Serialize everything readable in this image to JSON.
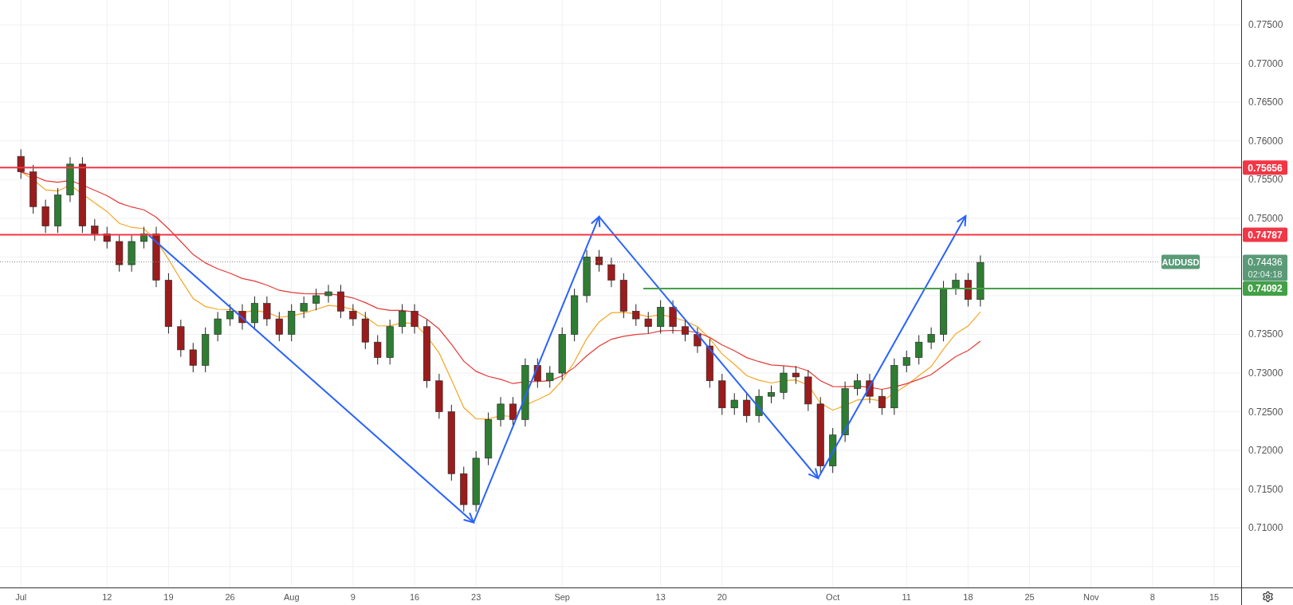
{
  "price_axis": {
    "labels": [
      "0.77500",
      "0.77000",
      "0.76500",
      "0.76000",
      "0.75500",
      "0.75000",
      "0.73500",
      "0.73000",
      "0.72500",
      "0.72000",
      "0.71500",
      "0.71000"
    ]
  },
  "time_axis": {
    "labels": [
      "Jul",
      "12",
      "19",
      "26",
      "Aug",
      "9",
      "16",
      "23",
      "Sep",
      "13",
      "20",
      "Oct",
      "11",
      "18",
      "25",
      "Nov",
      "8",
      "15"
    ]
  },
  "levels": [
    {
      "price": "0.75656",
      "color": "#f23645"
    },
    {
      "price": "0.74787",
      "color": "#f23645"
    },
    {
      "price": "0.74092",
      "color": "#43a047"
    }
  ],
  "last_price": {
    "symbol": "AUDUSD",
    "price": "0.74436",
    "countdown": "02:04:18"
  }
}
